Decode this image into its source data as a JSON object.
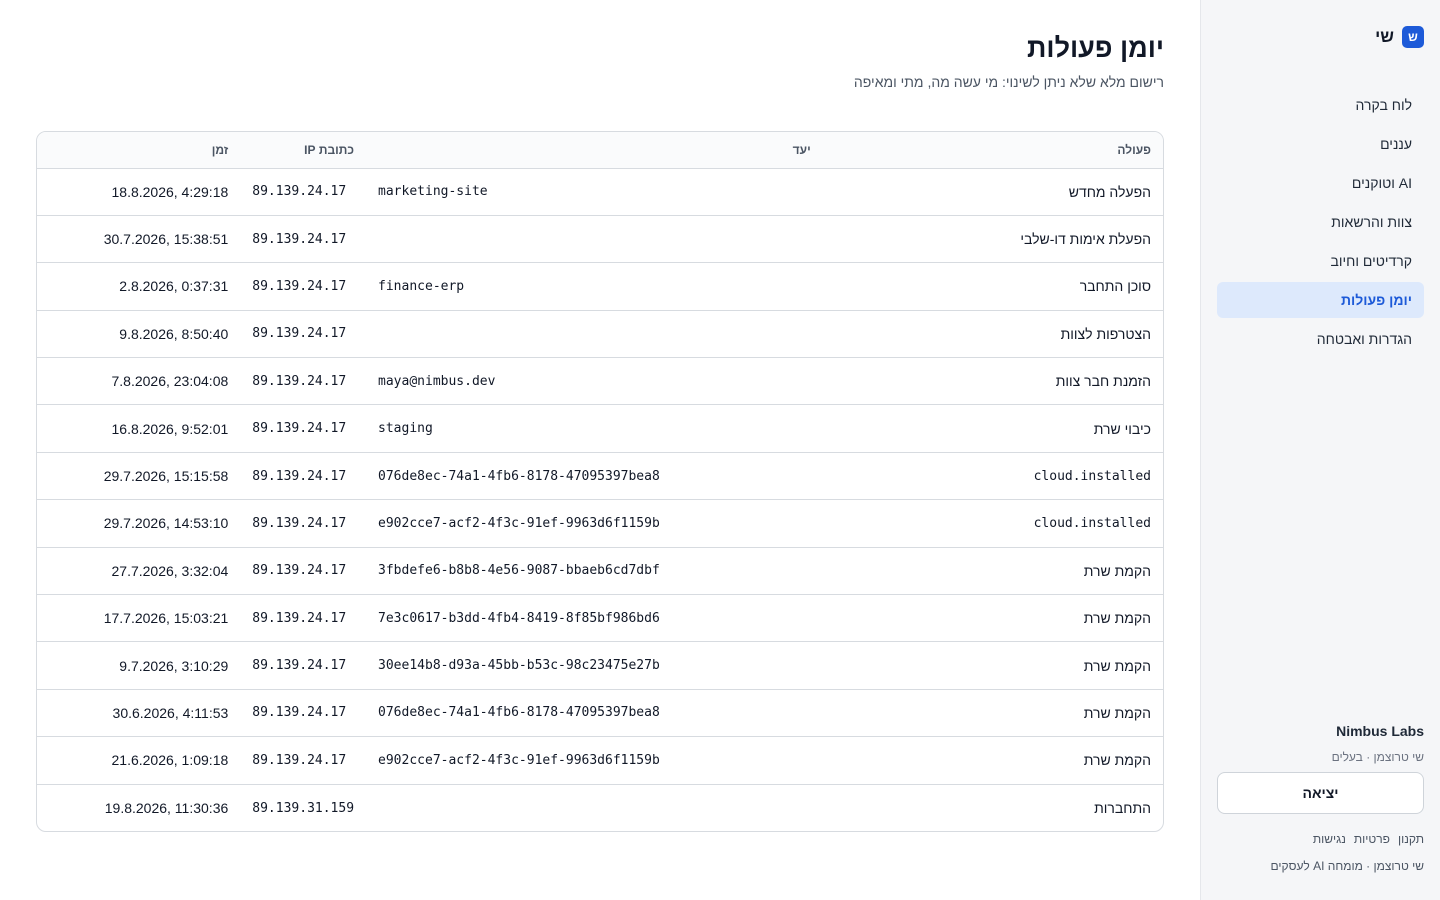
{
  "sidebar": {
    "brand": {
      "logo_letter": "ש",
      "name": "שי"
    },
    "items": [
      {
        "label": "לוח בקרה",
        "active": false
      },
      {
        "label": "עננים",
        "active": false
      },
      {
        "label": "AI וטוקנים",
        "active": false
      },
      {
        "label": "צוות והרשאות",
        "active": false
      },
      {
        "label": "קרדיטים וחיוב",
        "active": false
      },
      {
        "label": "יומן פעולות",
        "active": true
      },
      {
        "label": "הגדרות ואבטחה",
        "active": false
      }
    ],
    "org_name": "Nimbus Labs",
    "user_role": "שי טרוצמן · בעלים",
    "logout_label": "יציאה",
    "footer_links": [
      "תקנון",
      "פרטיות",
      "נגישות"
    ],
    "footer_credit": "שי טרוצמן · מומחה AI לעסקים"
  },
  "main": {
    "title": "יומן פעולות",
    "subtitle": "רישום מלא שלא ניתן לשינוי: מי עשה מה, מתי ומאיפה",
    "table": {
      "columns": [
        "פעולה",
        "יעד",
        "כתובת IP",
        "זמן"
      ],
      "rows": [
        {
          "action": "הפעלה מחדש",
          "target": "marketing-site",
          "ip": "89.139.24.17",
          "time": "18.8.2026, 4:29:18"
        },
        {
          "action": "הפעלת אימות דו-שלבי",
          "target": "",
          "ip": "89.139.24.17",
          "time": "30.7.2026, 15:38:51"
        },
        {
          "action": "סוכן התחבר",
          "target": "finance-erp",
          "ip": "89.139.24.17",
          "time": "2.8.2026, 0:37:31"
        },
        {
          "action": "הצטרפות לצוות",
          "target": "",
          "ip": "89.139.24.17",
          "time": "9.8.2026, 8:50:40"
        },
        {
          "action": "הזמנת חבר צוות",
          "target": "maya@nimbus.dev",
          "ip": "89.139.24.17",
          "time": "7.8.2026, 23:04:08"
        },
        {
          "action": "כיבוי שרת",
          "target": "staging",
          "ip": "89.139.24.17",
          "time": "16.8.2026, 9:52:01"
        },
        {
          "action": "cloud.installed",
          "target": "076de8ec-74a1-4fb6-8178-47095397bea8",
          "ip": "89.139.24.17",
          "time": "29.7.2026, 15:15:58"
        },
        {
          "action": "cloud.installed",
          "target": "e902cce7-acf2-4f3c-91ef-9963d6f1159b",
          "ip": "89.139.24.17",
          "time": "29.7.2026, 14:53:10"
        },
        {
          "action": "הקמת שרת",
          "target": "3fbdefe6-b8b8-4e56-9087-bbaeb6cd7dbf",
          "ip": "89.139.24.17",
          "time": "27.7.2026, 3:32:04"
        },
        {
          "action": "הקמת שרת",
          "target": "7e3c0617-b3dd-4fb4-8419-8f85bf986bd6",
          "ip": "89.139.24.17",
          "time": "17.7.2026, 15:03:21"
        },
        {
          "action": "הקמת שרת",
          "target": "30ee14b8-d93a-45bb-b53c-98c23475e27b",
          "ip": "89.139.24.17",
          "time": "9.7.2026, 3:10:29"
        },
        {
          "action": "הקמת שרת",
          "target": "076de8ec-74a1-4fb6-8178-47095397bea8",
          "ip": "89.139.24.17",
          "time": "30.6.2026, 4:11:53"
        },
        {
          "action": "הקמת שרת",
          "target": "e902cce7-acf2-4f3c-91ef-9963d6f1159b",
          "ip": "89.139.24.17",
          "time": "21.6.2026, 1:09:18"
        },
        {
          "action": "התחברות",
          "target": "",
          "ip": "89.139.31.159",
          "time": "19.8.2026, 11:30:36"
        }
      ]
    }
  },
  "colors": {
    "accent": "#1d5ad8",
    "active_nav_bg": "#dde9fc",
    "sidebar_bg": "#f5f6f8",
    "border": "#d7dbe0"
  }
}
